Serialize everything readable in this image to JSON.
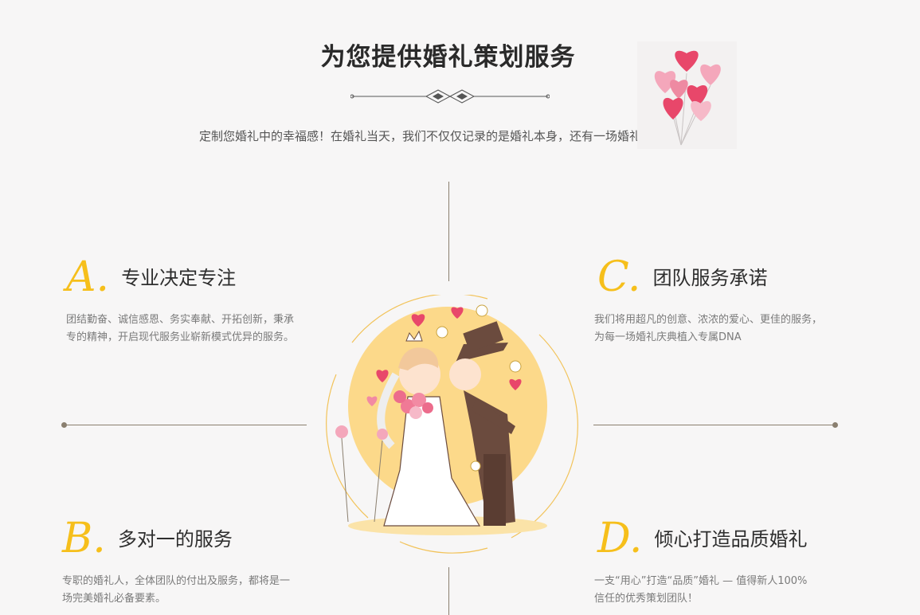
{
  "header": {
    "title": "为您提供婚礼策划服务",
    "subtitle": "定制您婚礼中的幸福感！在婚礼当天，我们不仅仅记录的是婚礼本身，还有一场婚礼的气质！"
  },
  "features": [
    {
      "letter": "A.",
      "title": "专业决定专注",
      "desc_line1": "团结勤奋、诚信感恩、务实奉献、开拓创新，秉承",
      "desc_line2": "专的精神，开启现代服务业崭新模式优异的服务。"
    },
    {
      "letter": "B.",
      "title": "多对一的服务",
      "desc_line1": "专职的婚礼人，全体团队的付出及服务，都将是一",
      "desc_line2": "场完美婚礼必备要素。"
    },
    {
      "letter": "C.",
      "title": "团队服务承诺",
      "desc_line1": "我们将用超凡的创意、浓浓的爱心、更佳的服务，",
      "desc_line2": "为每一场婚礼庆典植入专属DNA"
    },
    {
      "letter": "D.",
      "title": "倾心打造品质婚礼",
      "desc_line1": "一支“用心”打造“品质”婚礼 — 值得新人100%",
      "desc_line2": "信任的优秀策划团队！"
    }
  ],
  "colors": {
    "accent": "#f6bf1b",
    "line": "#8a7f6f"
  },
  "icons": [
    "ornament-divider-icon",
    "heart-balloons-icon",
    "wedding-couple-illustration"
  ]
}
